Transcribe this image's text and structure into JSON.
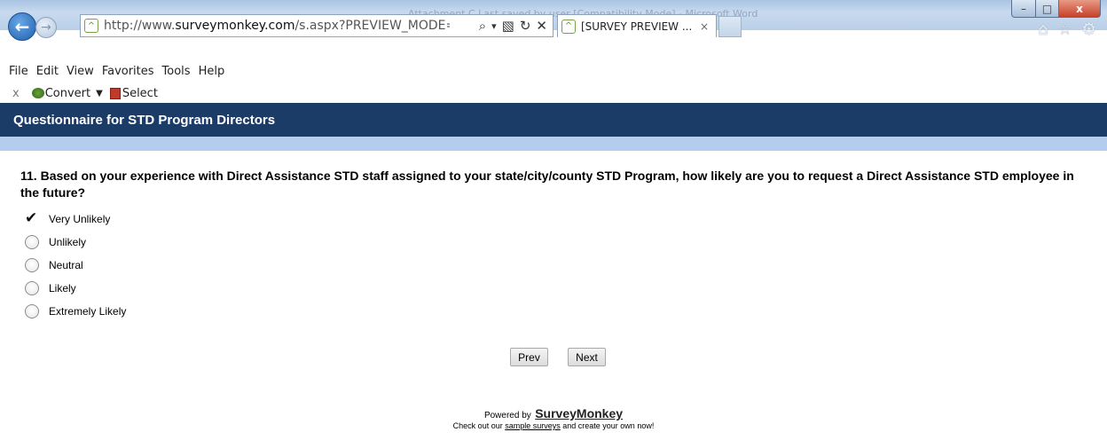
{
  "window": {
    "title": "Attachment C Last saved by user [Compatibility Mode] - Microsoft Word",
    "minimize_glyph": "–",
    "maximize_glyph": "□",
    "close_glyph": "x"
  },
  "browser": {
    "back_glyph": "←",
    "forward_glyph": "→",
    "favicon_glyph": "^",
    "url_prefix": "http://www.",
    "url_domain": "surveymonkey.com",
    "url_rest": "/s.aspx?PREVIEW_MODE=DO_NO",
    "search_glyph": "⌕",
    "dropdown_glyph": "▾",
    "compat_glyph": "▧",
    "refresh_glyph": "↻",
    "stop_glyph": "✕",
    "tab_title": "[SURVEY PREVIEW ...",
    "tab_close_glyph": "×",
    "home_glyph": "⌂",
    "favorites_glyph": "☆",
    "settings_glyph": "⚙"
  },
  "menu": [
    "File",
    "Edit",
    "View",
    "Favorites",
    "Tools",
    "Help"
  ],
  "commandbar": {
    "close_glyph": "x",
    "convert_label": "Convert",
    "caret_glyph": "▼",
    "select_label": "Select"
  },
  "survey": {
    "header_title": "Questionnaire for STD Program Directors",
    "question": "11. Based on your experience with Direct Assistance STD staff assigned to your state/city/county STD Program, how likely are you to request a Direct Assistance STD employee in the future?",
    "options": [
      {
        "label": "Very Unlikely",
        "selected": true
      },
      {
        "label": "Unlikely",
        "selected": false
      },
      {
        "label": "Neutral",
        "selected": false
      },
      {
        "label": "Likely",
        "selected": false
      },
      {
        "label": "Extremely Likely",
        "selected": false
      }
    ],
    "prev_label": "Prev",
    "next_label": "Next"
  },
  "footer": {
    "powered_by": "Powered by",
    "brand": "SurveyMonkey",
    "line2_prefix": "Check out our",
    "line2_link": "sample surveys",
    "line2_suffix": "and create your own now!"
  }
}
